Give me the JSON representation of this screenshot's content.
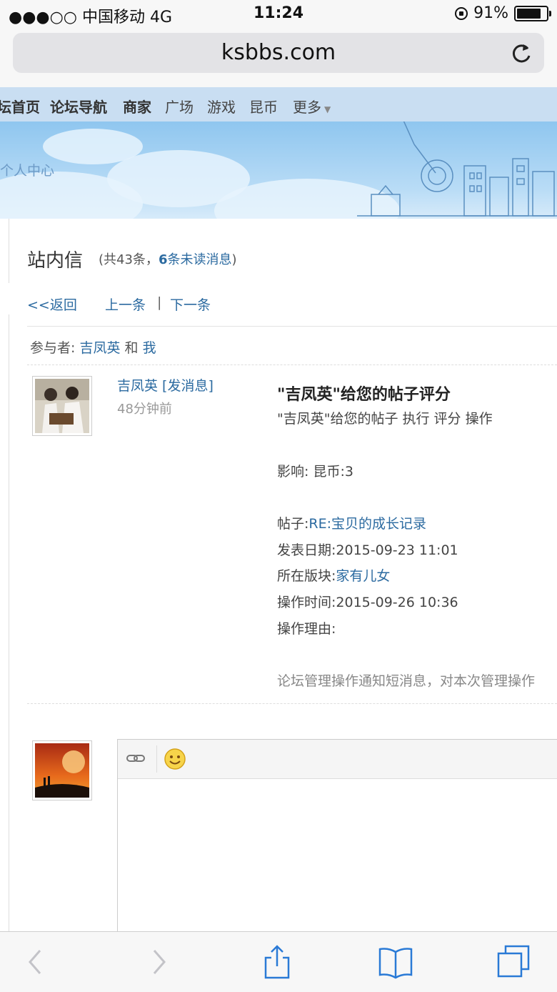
{
  "status_bar": {
    "carrier": "●●●○○ 中国移动  4G",
    "time": "11:24",
    "battery": "91%",
    "battery_level": 0.91
  },
  "browser": {
    "url": "ksbbs.com"
  },
  "forum_nav": {
    "items": [
      "坛首页",
      "论坛导航",
      "商家",
      "广场",
      "游戏",
      "昆币",
      "更多"
    ]
  },
  "banner": {
    "personal_center": "个人中心"
  },
  "inbox": {
    "title": "站内信",
    "meta_prefix": "(共43条，",
    "unread_count": "6",
    "meta_unread_suffix": "条未读消息",
    "meta_close": ")",
    "back": "<<返回",
    "prev": "上一条",
    "separator": "|",
    "next": "下一条"
  },
  "participants": {
    "label": "参与者:",
    "user": "吉凤英",
    "and": "和",
    "me": "我"
  },
  "message": {
    "sender": "吉凤英 [发消息]",
    "time_ago": "48分钟前",
    "title": "\"吉凤英\"给您的帖子评分",
    "summary": "\"吉凤英\"给您的帖子 执行 评分 操作",
    "impact_label": "影响:",
    "impact_value": "昆币:3",
    "post_label": "帖子:",
    "post_value": "RE:宝贝的成长记录",
    "date_label": "发表日期:",
    "date_value": "2015-09-23 11:01",
    "board_label": "所在版块:",
    "board_value": "家有儿女",
    "optime_label": "操作时间:",
    "optime_value": "2015-09-26 10:36",
    "reason_label": "操作理由:",
    "footer": "论坛管理操作通知短消息，对本次管理操作"
  },
  "editor": {
    "tools": [
      "link-icon",
      "smiley-icon"
    ]
  },
  "colors": {
    "link": "#2b6aa0",
    "nav_bg": "#c9def2"
  }
}
